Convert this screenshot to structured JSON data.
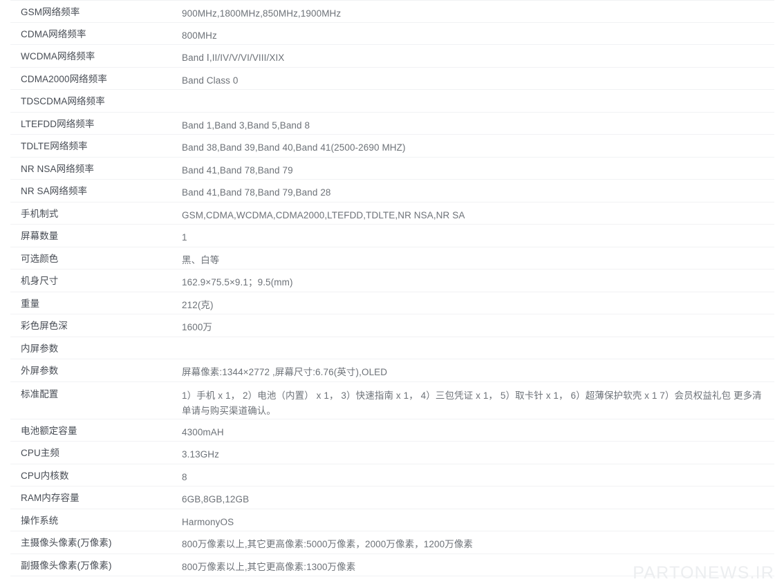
{
  "watermark": {
    "text": "PARTONEWS.IR",
    "color": "#eceef0"
  },
  "colors": {
    "background": "#ffffff",
    "label_text": "#474c54",
    "value_text": "#6d7278",
    "divider": "#f1f2f4"
  },
  "spec_table": {
    "rows": [
      {
        "label": "GSM网络频率",
        "value": "900MHz,1800MHz,850MHz,1900MHz"
      },
      {
        "label": "CDMA网络频率",
        "value": "800MHz"
      },
      {
        "label": "WCDMA网络频率",
        "value": "Band Ⅰ,II/IV/V/VI/VIII/XIX"
      },
      {
        "label": "CDMA2000网络频率",
        "value": "Band Class 0"
      },
      {
        "label": "TDSCDMA网络频率",
        "value": ""
      },
      {
        "label": "LTEFDD网络频率",
        "value": "Band 1,Band 3,Band 5,Band 8"
      },
      {
        "label": "TDLTE网络频率",
        "value": "Band 38,Band 39,Band 40,Band 41(2500-2690 MHZ)"
      },
      {
        "label": "NR NSA网络频率",
        "value": "Band 41,Band 78,Band 79"
      },
      {
        "label": "NR SA网络频率",
        "value": "Band 41,Band 78,Band 79,Band 28"
      },
      {
        "label": "手机制式",
        "value": "GSM,CDMA,WCDMA,CDMA2000,LTEFDD,TDLTE,NR NSA,NR SA"
      },
      {
        "label": "屏幕数量",
        "value": "1"
      },
      {
        "label": "可选颜色",
        "value": "黑、白等"
      },
      {
        "label": "机身尺寸",
        "value": "162.9×75.5×9.1；9.5(mm)"
      },
      {
        "label": "重量",
        "value": "212(克)"
      },
      {
        "label": "彩色屏色深",
        "value": "1600万"
      },
      {
        "label": "内屏参数",
        "value": ""
      },
      {
        "label": "外屏参数",
        "value": "屏幕像素:1344×2772 ,屏幕尺寸:6.76(英寸),OLED"
      },
      {
        "label": "标准配置",
        "value": "1）手机 x 1， 2）电池（内置） x 1， 3）快速指南 x 1， 4）三包凭证 x 1， 5）取卡针 x 1， 6）超薄保护软壳 x 1 7）会员权益礼包 更多清单请与购买渠道确认。",
        "tall": true
      },
      {
        "label": "电池额定容量",
        "value": "4300mAH"
      },
      {
        "label": "CPU主频",
        "value": "3.13GHz"
      },
      {
        "label": "CPU内核数",
        "value": "8"
      },
      {
        "label": "RAM内存容量",
        "value": "6GB,8GB,12GB"
      },
      {
        "label": "操作系统",
        "value": "HarmonyOS"
      },
      {
        "label": "主摄像头像素(万像素)",
        "value": "800万像素以上,其它更高像素:5000万像素，2000万像素，1200万像素"
      },
      {
        "label": "副摄像头像素(万像素)",
        "value": "800万像素以上,其它更高像素:1300万像素"
      }
    ]
  }
}
